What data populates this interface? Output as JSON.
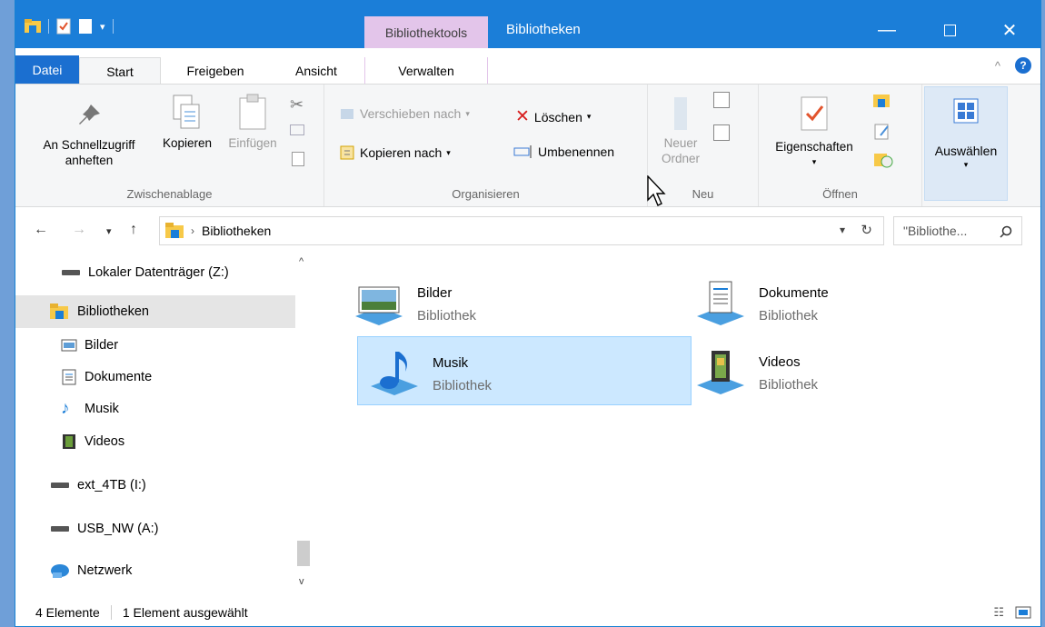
{
  "titlebar": {
    "tool_tab": "Bibliothektools",
    "title": "Bibliotheken",
    "accent": "#1b7ed8",
    "tool_tab_color": "#e3c5ea"
  },
  "tabs": {
    "datei": "Datei",
    "start": "Start",
    "freigeben": "Freigeben",
    "ansicht": "Ansicht",
    "verwalten": "Verwalten"
  },
  "ribbon": {
    "clipboard": {
      "pin": "An Schnellzugriff anheften",
      "copy": "Kopieren",
      "paste": "Einfügen",
      "label": "Zwischenablage"
    },
    "organize": {
      "move": "Verschieben nach",
      "copy_to": "Kopieren nach",
      "delete": "Löschen",
      "rename": "Umbenennen",
      "label": "Organisieren"
    },
    "new": {
      "folder": "Neuer Ordner",
      "label": "Neu"
    },
    "open": {
      "properties": "Eigenschaften",
      "label": "Öffnen"
    },
    "select": {
      "label": "Auswählen"
    }
  },
  "address": {
    "path": "Bibliotheken",
    "search_placeholder": "\"Bibliothe..."
  },
  "nav": {
    "items": [
      {
        "label": "Lokaler Datenträger (Z:)",
        "icon": "drive-icon"
      },
      {
        "label": "Bibliotheken",
        "icon": "libraries-icon",
        "selected": true
      },
      {
        "label": "Bilder",
        "icon": "pictures-icon"
      },
      {
        "label": "Dokumente",
        "icon": "documents-icon"
      },
      {
        "label": "Musik",
        "icon": "music-icon"
      },
      {
        "label": "Videos",
        "icon": "videos-icon"
      },
      {
        "label": "ext_4TB (I:)",
        "icon": "drive-icon"
      },
      {
        "label": "USB_NW (A:)",
        "icon": "drive-icon"
      },
      {
        "label": "Netzwerk",
        "icon": "network-icon"
      }
    ]
  },
  "libraries": [
    {
      "name": "Bilder",
      "type": "Bibliothek",
      "icon": "pictures-library-icon"
    },
    {
      "name": "Dokumente",
      "type": "Bibliothek",
      "icon": "documents-library-icon"
    },
    {
      "name": "Musik",
      "type": "Bibliothek",
      "icon": "music-library-icon",
      "selected": true
    },
    {
      "name": "Videos",
      "type": "Bibliothek",
      "icon": "videos-library-icon"
    }
  ],
  "status": {
    "count": "4 Elemente",
    "selected": "1 Element ausgewählt"
  }
}
